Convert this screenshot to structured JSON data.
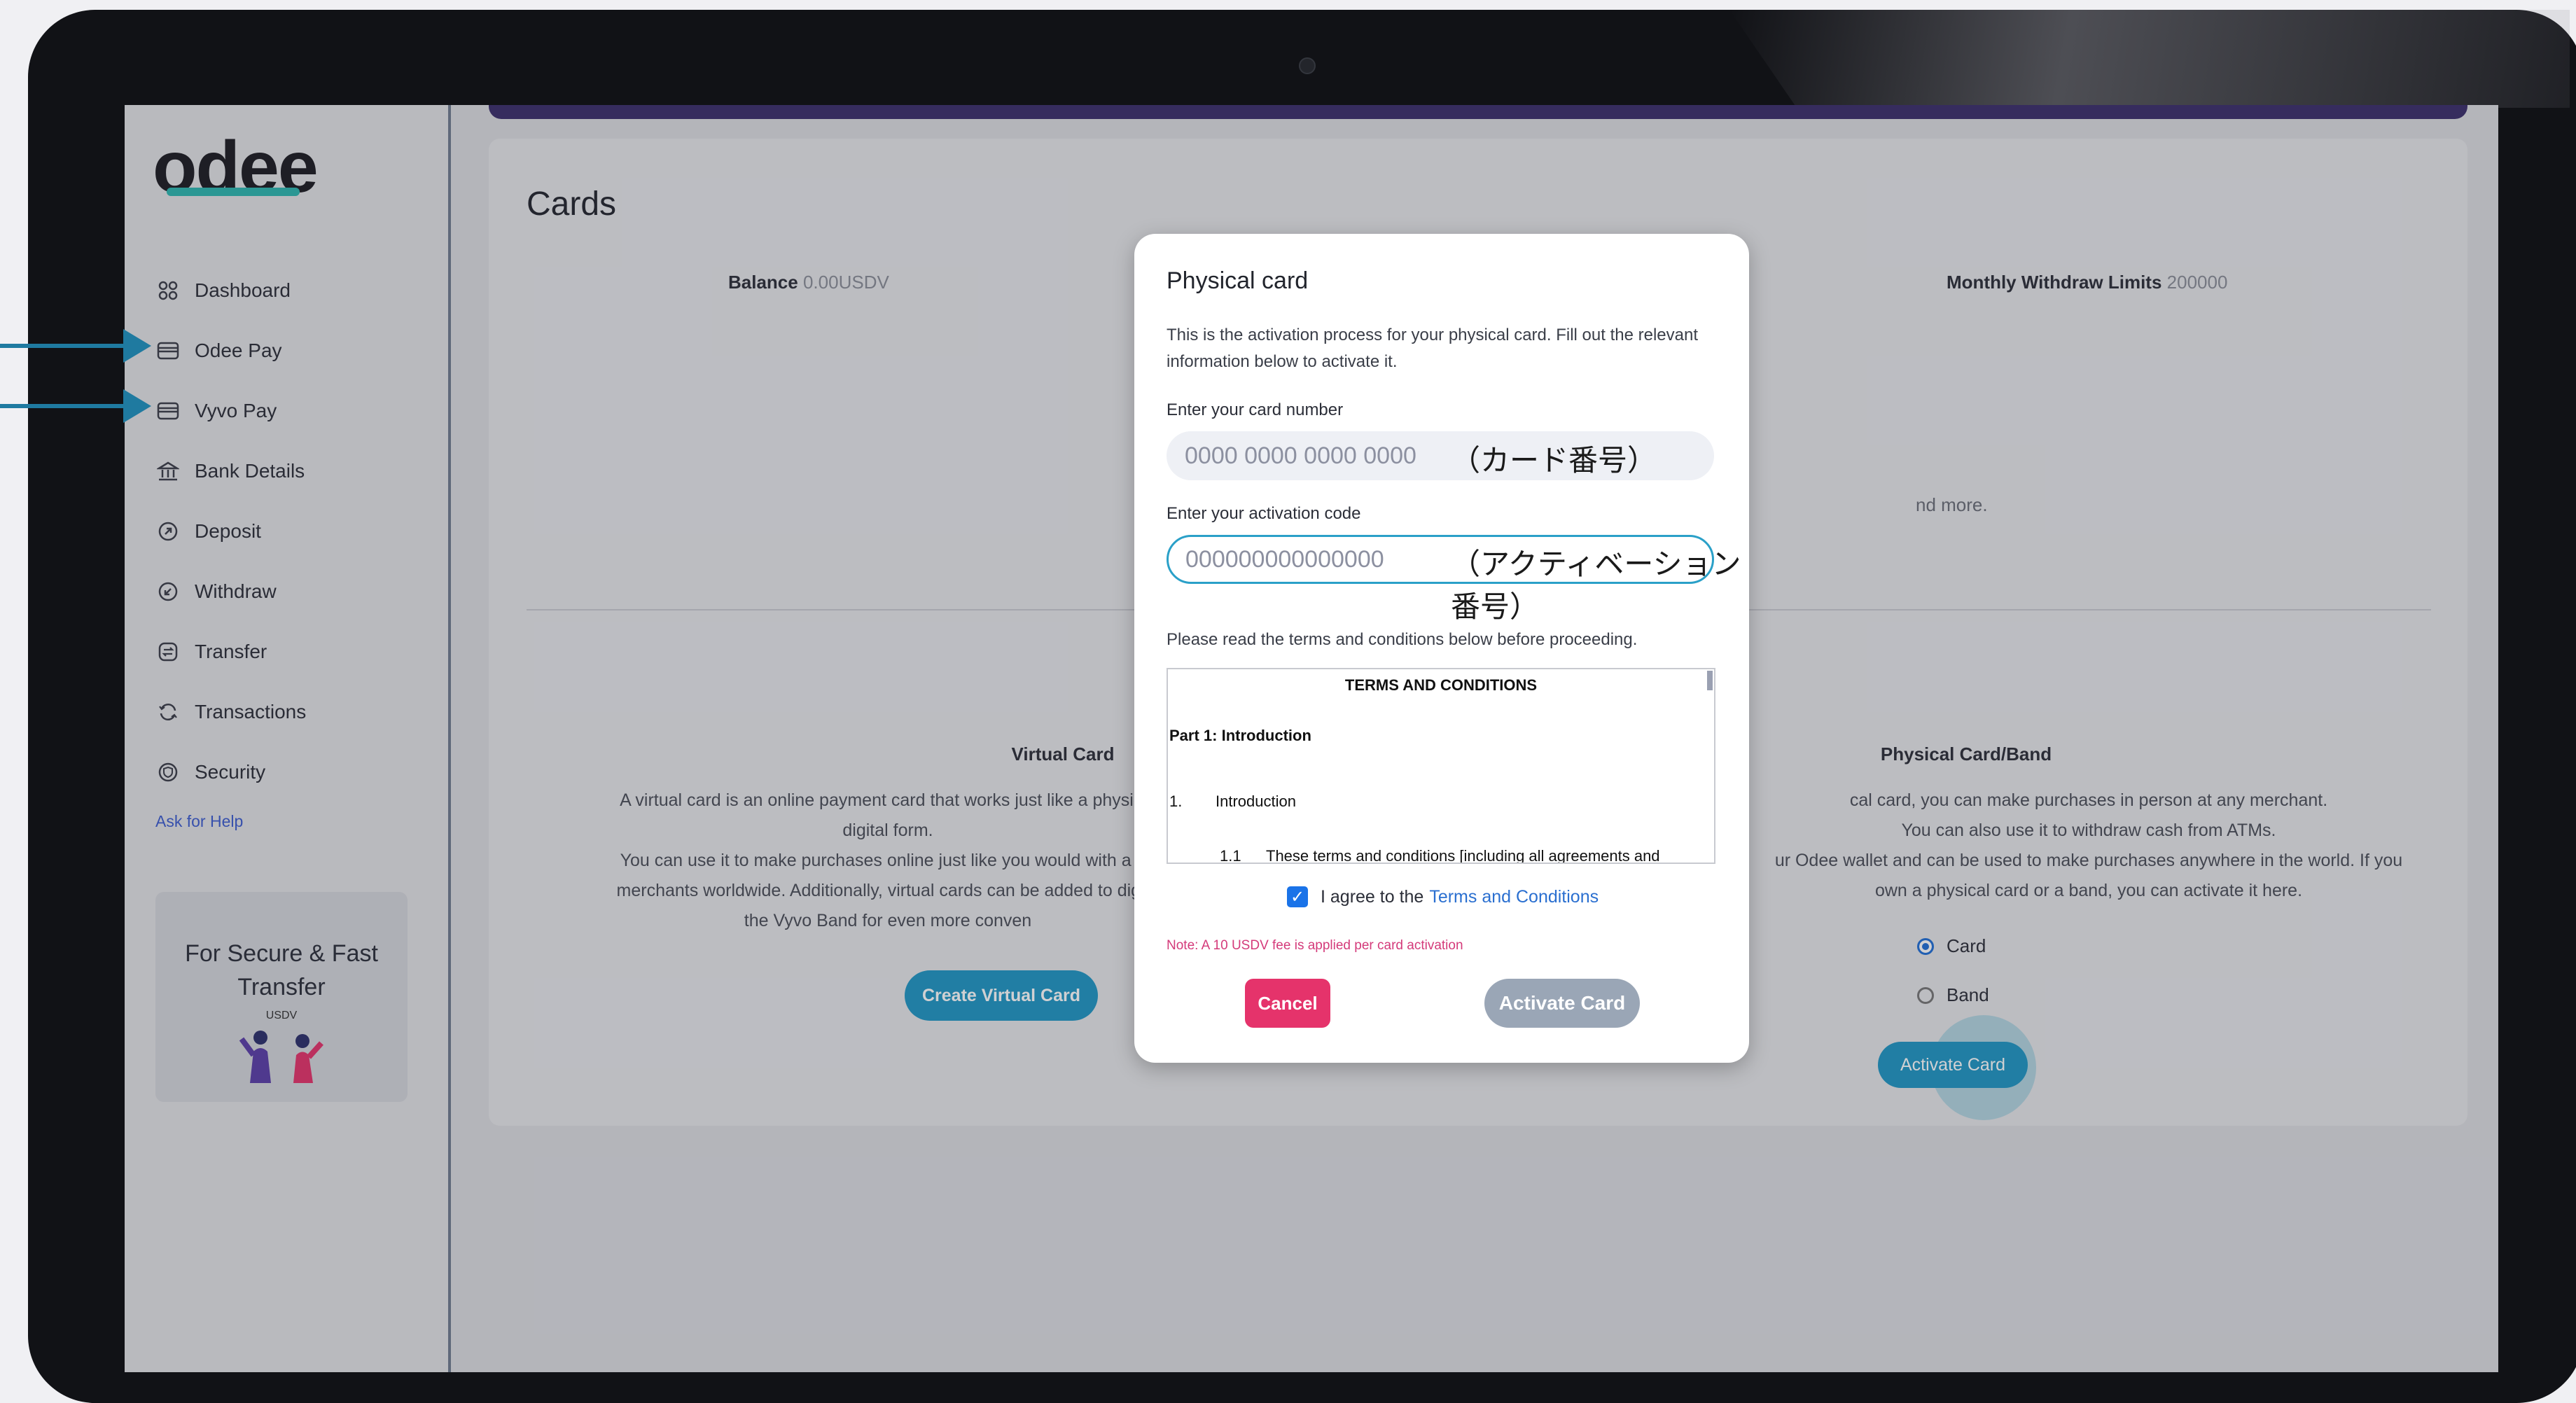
{
  "sidebar": {
    "logo": "odee",
    "items": [
      {
        "label": "Dashboard",
        "icon": "dashboard-icon"
      },
      {
        "label": "Odee Pay",
        "icon": "card-icon"
      },
      {
        "label": "Vyvo Pay",
        "icon": "card-icon"
      },
      {
        "label": "Bank Details",
        "icon": "bank-icon"
      },
      {
        "label": "Deposit",
        "icon": "deposit-icon"
      },
      {
        "label": "Withdraw",
        "icon": "withdraw-icon"
      },
      {
        "label": "Transfer",
        "icon": "transfer-icon"
      },
      {
        "label": "Transactions",
        "icon": "transactions-icon"
      },
      {
        "label": "Security",
        "icon": "shield-icon"
      }
    ],
    "help": "Ask for Help",
    "promo": {
      "title": "For Secure & Fast Transfer",
      "coin": "USDV"
    }
  },
  "main": {
    "title": "Cards",
    "balance_label": "Balance",
    "balance_value": "0.00USDV",
    "limit_label": "Monthly Withdraw Limits",
    "limit_value": "200000",
    "partial_more": "nd more.",
    "virtual": {
      "title": "Virtual Card",
      "lines": [
        "A virtual card is an online payment card that works just like a physical",
        "digital form.",
        "You can use it to make purchases online just like you would with a ph",
        "merchants worldwide. Additionally, virtual cards can be added to digita",
        "the Vyvo Band for even more conven"
      ],
      "button": "Create Virtual Card",
      "fragment": "convenience."
    },
    "physical": {
      "title": "Physical Card/Band",
      "lines": [
        "cal card, you can make purchases in person at any merchant.",
        "You can also use it to withdraw cash from ATMs.",
        "ur Odee wallet and can be used to make purchases anywhere in the world. If you",
        "own a physical card or a band, you can activate it here."
      ],
      "option_card": "Card",
      "option_band": "Band",
      "selected": "Card",
      "button": "Activate Card"
    }
  },
  "modal": {
    "title": "Physical card",
    "description": "This is the activation process for your physical card. Fill out the relevant information below to activate it.",
    "card_number_label": "Enter your card number",
    "card_number_placeholder": "0000 0000 0000 0000",
    "card_number_annotation": "（カード番号）",
    "activation_label": "Enter your activation code",
    "activation_placeholder": "000000000000000",
    "activation_annotation": "（アクティベーション番号）",
    "terms_note": "Please read the terms and conditions below before proceeding.",
    "terms": {
      "heading": "TERMS AND CONDITIONS",
      "part": "Part 1: Introduction",
      "line1_num": "1.",
      "line1_text": "Introduction",
      "line2_num": "1.1",
      "line2_text": "These terms and conditions [including all agreements and"
    },
    "agree_text": "I agree to the",
    "agree_link": "Terms and Conditions",
    "agree_checked": true,
    "fee_note": "Note: A 10 USDV fee is applied per card activation",
    "cancel": "Cancel",
    "activate": "Activate Card"
  },
  "colors": {
    "accent": "#1f97c4",
    "cancel": "#e5336b",
    "arrow": "#1f7aa0"
  }
}
